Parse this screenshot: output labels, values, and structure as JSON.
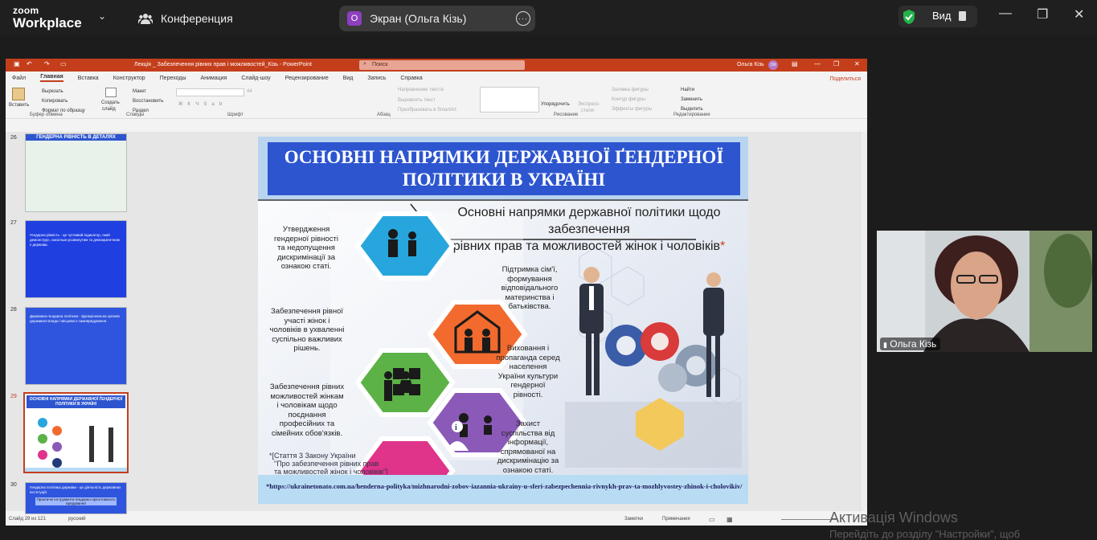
{
  "zoom": {
    "logo_top": "zoom",
    "logo_bottom": "Workplace",
    "tab_conference": "Конференция",
    "tab_screen": "Экран (Ольга Кізь)",
    "screen_initial": "О",
    "view_label": "Вид"
  },
  "ppt": {
    "window_title": "Лекція _ Забезпечення рівних прав і можливостей_Кізь  -  PowerPoint",
    "search_placeholder": "Поиск",
    "user_name": "Ольга Кізь",
    "user_initials": "ОК",
    "menu": [
      "Файл",
      "Главная",
      "Вставка",
      "Конструктор",
      "Переходы",
      "Анимация",
      "Слайд-шоу",
      "Рецензирование",
      "Вид",
      "Запись",
      "Справка"
    ],
    "share_label": "Поделиться",
    "ribbon": {
      "paste": "Вставить",
      "cut": "Вырезать",
      "copy": "Копировать",
      "format_painter": "Формат по образцу",
      "clipboard_group": "Буфер обмена",
      "new_slide_1": "Создать",
      "new_slide_2": "слайд",
      "layout": "Макет",
      "reset": "Восстановить",
      "section": "Раздел",
      "slides_group": "Слайды",
      "font_group": "Шрифт",
      "text_direction": "Направление текста",
      "align_text": "Выровнять текст",
      "smartart": "Преобразовать в SmartArt",
      "paragraph_group": "Абзац",
      "arrange": "Упорядочить",
      "express_1": "Экспресс-",
      "express_2": "стили",
      "fill": "Заливка фигуры",
      "outline": "Контур фигуры",
      "effects": "Эффекты фигуры",
      "drawing_group": "Рисование",
      "find": "Найти",
      "replace": "Заменить",
      "select": "Выделить",
      "editing_group": "Редактирование",
      "font_size": "44"
    },
    "thumbnails": [
      {
        "num": "26",
        "title": "ГЕНДЕРНА РІВНІСТЬ В ДЕТАЛЯХ"
      },
      {
        "num": "27",
        "text": "Гендерна рівність - це чутливий індикатор, який демонструє, наскільки розвинутим та демократичним є держава."
      },
      {
        "num": "28",
        "text": "Державна гендерна політика - функціональна органів державної влади і місцевого самоврядування."
      },
      {
        "num": "29",
        "title": "ОСНОВНІ НАПРЯМКИ ДЕРЖАВНОЇ ҐЕНДЕРНОЇ ПОЛІТИКИ В УКРАЇНІ"
      },
      {
        "num": "30",
        "text": "Гендерна політика держави - це діяльність державних інституцій.",
        "button": "Практичні інструменти гендерно-орієнтованого врядування"
      }
    ],
    "slide": {
      "title_line1": "ОСНОВНІ НАПРЯМКИ ДЕРЖАВНОЇ ҐЕНДЕРНОЇ",
      "title_line2": "ПОЛІТИКИ В УКРАЇНІ",
      "subtitle_line1": "Основні напрямки державної політики щодо забезпечення",
      "subtitle_line2": "рівних прав та можливостей жінок і чоловіків",
      "subtitle_mark": "*",
      "items": [
        "Утвердження гендерної рівності та недопущення дискримінації за ознакою статі.",
        "Підтримка сім'ї, формування відповідального материнства і батьківства.",
        "Забезпечення рівної участі жінок і чоловіків в ухваленні суспільно важливих рішень.",
        "Виховання і пропаганда серед населення України культури гендерної рівності.",
        "Забезпечення рівних можливостей жінкам і чоловікам щодо поєднання професійних та сімейних обов'язків.",
        "Захист суспільства від інформації, спрямованої на дискримінацію за ознакою статі."
      ],
      "law_line1": "*[Стаття 3 Закону України",
      "law_line2": "\"Про забезпечення рівних прав",
      "law_line3": "та можливостей жінок і чоловіків\"]",
      "footnote": "*https://ukrainetonato.com.ua/henderna-polityka/mizhnarodni-zobov-iazannia-ukrainy-u-sferi-zabezpechennia-rivnykh-prav-ta-mozhlyvostey-zhinok-i-cholovikiv/"
    },
    "status": {
      "slide_counter": "Слайд 29 из 121",
      "language": "русский",
      "notes": "Заметки",
      "comments": "Примечания"
    }
  },
  "webcam": {
    "name": "Ольга Кізь"
  },
  "watermark": {
    "line1": "Активація Windows",
    "line2": "Перейдіть до розділу \"Настройки\", щоб"
  },
  "colors": {
    "accent": "#c43e1c",
    "slide_title_bg": "#2d55cf",
    "hex_blue": "#27a6dd",
    "hex_orange": "#f26a2e",
    "hex_green": "#5cb246",
    "hex_purple": "#8b59b8",
    "hex_pink": "#e0338a",
    "hex_navy": "#233a7a"
  }
}
